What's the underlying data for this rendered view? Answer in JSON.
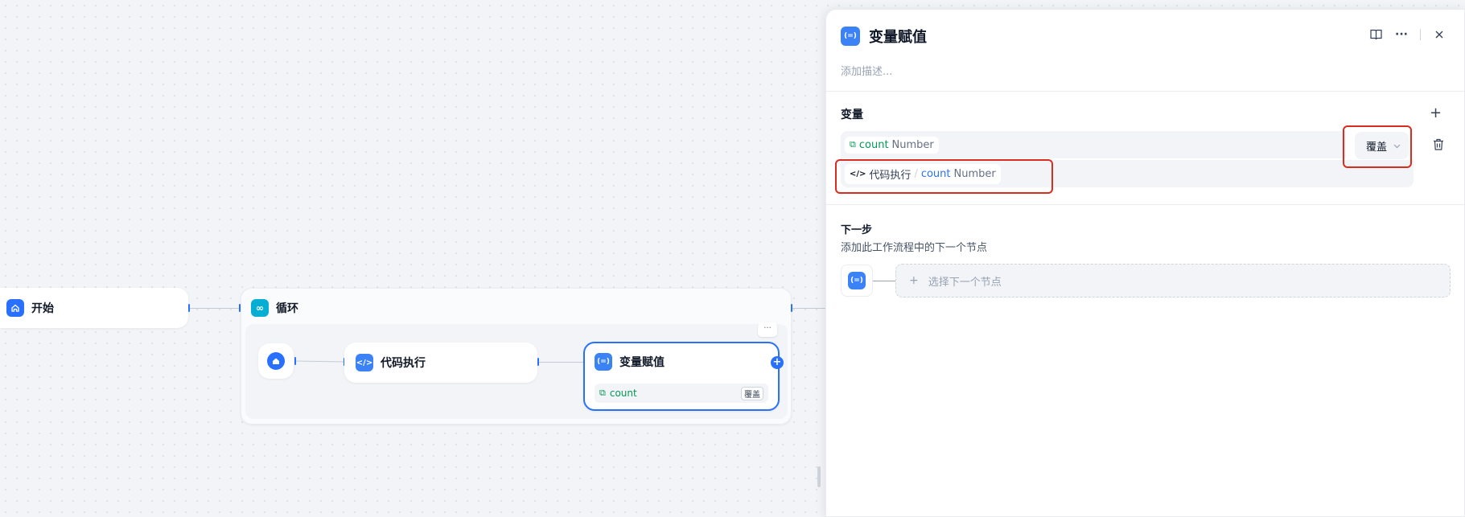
{
  "canvas": {
    "start_node": {
      "title": "开始"
    },
    "loop_node": {
      "title": "循环",
      "more_label": "···"
    },
    "code_node": {
      "title": "代码执行"
    },
    "assign_node": {
      "title": "变量赋值",
      "var_name": "count",
      "mode_badge": "覆盖",
      "add_label": "+"
    }
  },
  "panel": {
    "title": "变量赋值",
    "description_placeholder": "添加描述...",
    "icons": {
      "book": "book-icon",
      "more": "more-icon",
      "close": "close-icon"
    },
    "variables": {
      "section_title": "变量",
      "add_label": "+",
      "target": {
        "name": "count",
        "type": "Number"
      },
      "mode": {
        "value": "覆盖"
      },
      "source": {
        "node": "代码执行",
        "separator": "/",
        "name": "count",
        "type": "Number"
      }
    },
    "next": {
      "title": "下一步",
      "subtitle": "添加此工作流程中的下一个节点",
      "select_label": "选择下一个节点",
      "plus": "+"
    }
  },
  "colors": {
    "accent": "#2970ff",
    "loop": "#06aed4",
    "highlight": "#d92d20",
    "var_green": "#039855"
  }
}
